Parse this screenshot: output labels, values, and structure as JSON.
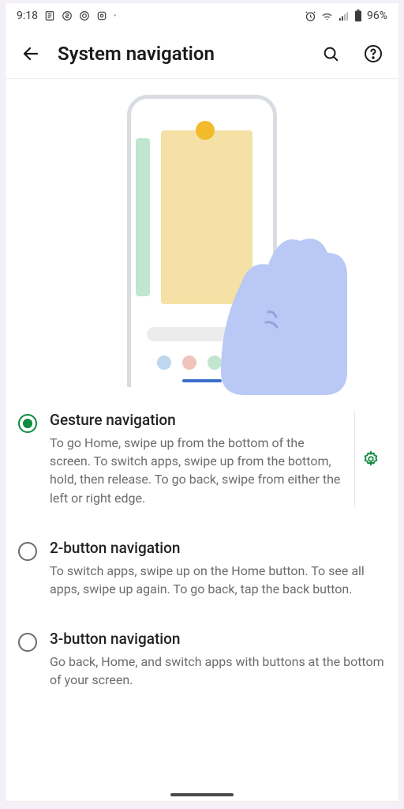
{
  "status": {
    "time": "9:18",
    "battery": "96%"
  },
  "header": {
    "title": "System navigation"
  },
  "options": [
    {
      "title": "Gesture navigation",
      "desc": "To go Home, swipe up from the bottom of the screen. To switch apps, swipe up from the bottom, hold, then release. To go back, swipe from either the left or right edge.",
      "selected": true,
      "settings": true
    },
    {
      "title": "2-button navigation",
      "desc": "To switch apps, swipe up on the Home button. To see all apps, swipe up again. To go back, tap the back button.",
      "selected": false,
      "settings": false
    },
    {
      "title": "3-button navigation",
      "desc": "Go back, Home, and switch apps with buttons at the bottom of your screen.",
      "selected": false,
      "settings": false
    }
  ]
}
